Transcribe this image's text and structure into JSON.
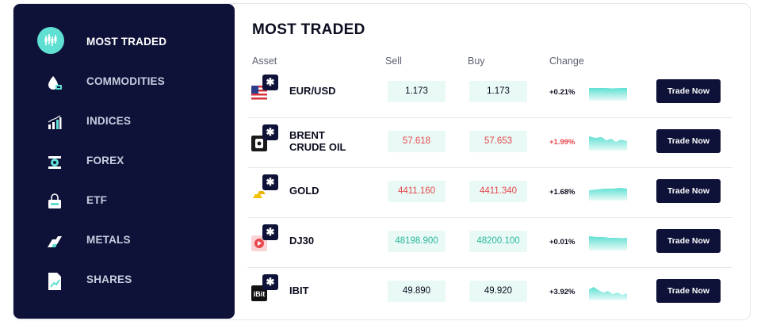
{
  "sidebar": {
    "items": [
      {
        "label": "MOST TRADED",
        "icon": "candlestick-chart-icon",
        "active": true
      },
      {
        "label": "COMMODITIES",
        "icon": "oil-drop-icon"
      },
      {
        "label": "INDICES",
        "icon": "bar-chart-icon"
      },
      {
        "label": "FOREX",
        "icon": "currency-exchange-icon"
      },
      {
        "label": "ETF",
        "icon": "basket-icon"
      },
      {
        "label": "METALS",
        "icon": "metal-bars-icon"
      },
      {
        "label": "SHARES",
        "icon": "share-document-icon"
      }
    ]
  },
  "main": {
    "title": "MOST TRADED",
    "columns": {
      "asset": "Asset",
      "sell": "Sell",
      "buy": "Buy",
      "change": "Change"
    },
    "rows": [
      {
        "name": "EUR/USD",
        "sell": "1.173",
        "buy": "1.173",
        "change": "+0.21%",
        "direction": "up",
        "icon": "us-flag-icon",
        "trade_label": "Trade Now"
      },
      {
        "name": "BRENT CRUDE OIL",
        "sell": "57.618",
        "buy": "57.653",
        "change": "+1.99%",
        "direction": "down",
        "icon": "oil-barrel-icon",
        "trade_label": "Trade Now"
      },
      {
        "name": "GOLD",
        "sell": "4411.160",
        "buy": "4411.340",
        "change": "+1.68%",
        "direction": "down",
        "icon": "gold-bars-icon",
        "trade_label": "Trade Now"
      },
      {
        "name": "DJ30",
        "sell": "48198.900",
        "buy": "48200.100",
        "change": "+0.01%",
        "direction": "up",
        "icon": "dj30-logo-icon",
        "trade_label": "Trade Now"
      },
      {
        "name": "IBIT",
        "sell": "49.890",
        "buy": "49.920",
        "change": "+3.92%",
        "direction": "neutral",
        "icon": "ibit-logo-icon",
        "trade_label": "Trade Now"
      }
    ]
  },
  "colors": {
    "sidebar_bg": "#0e1238",
    "accent_teal": "#5fe0d2",
    "price_bg": "#e9faf6",
    "up_text": "#28b79a",
    "down_text": "#e5484d",
    "neutral_text": "#0b0d1f"
  }
}
